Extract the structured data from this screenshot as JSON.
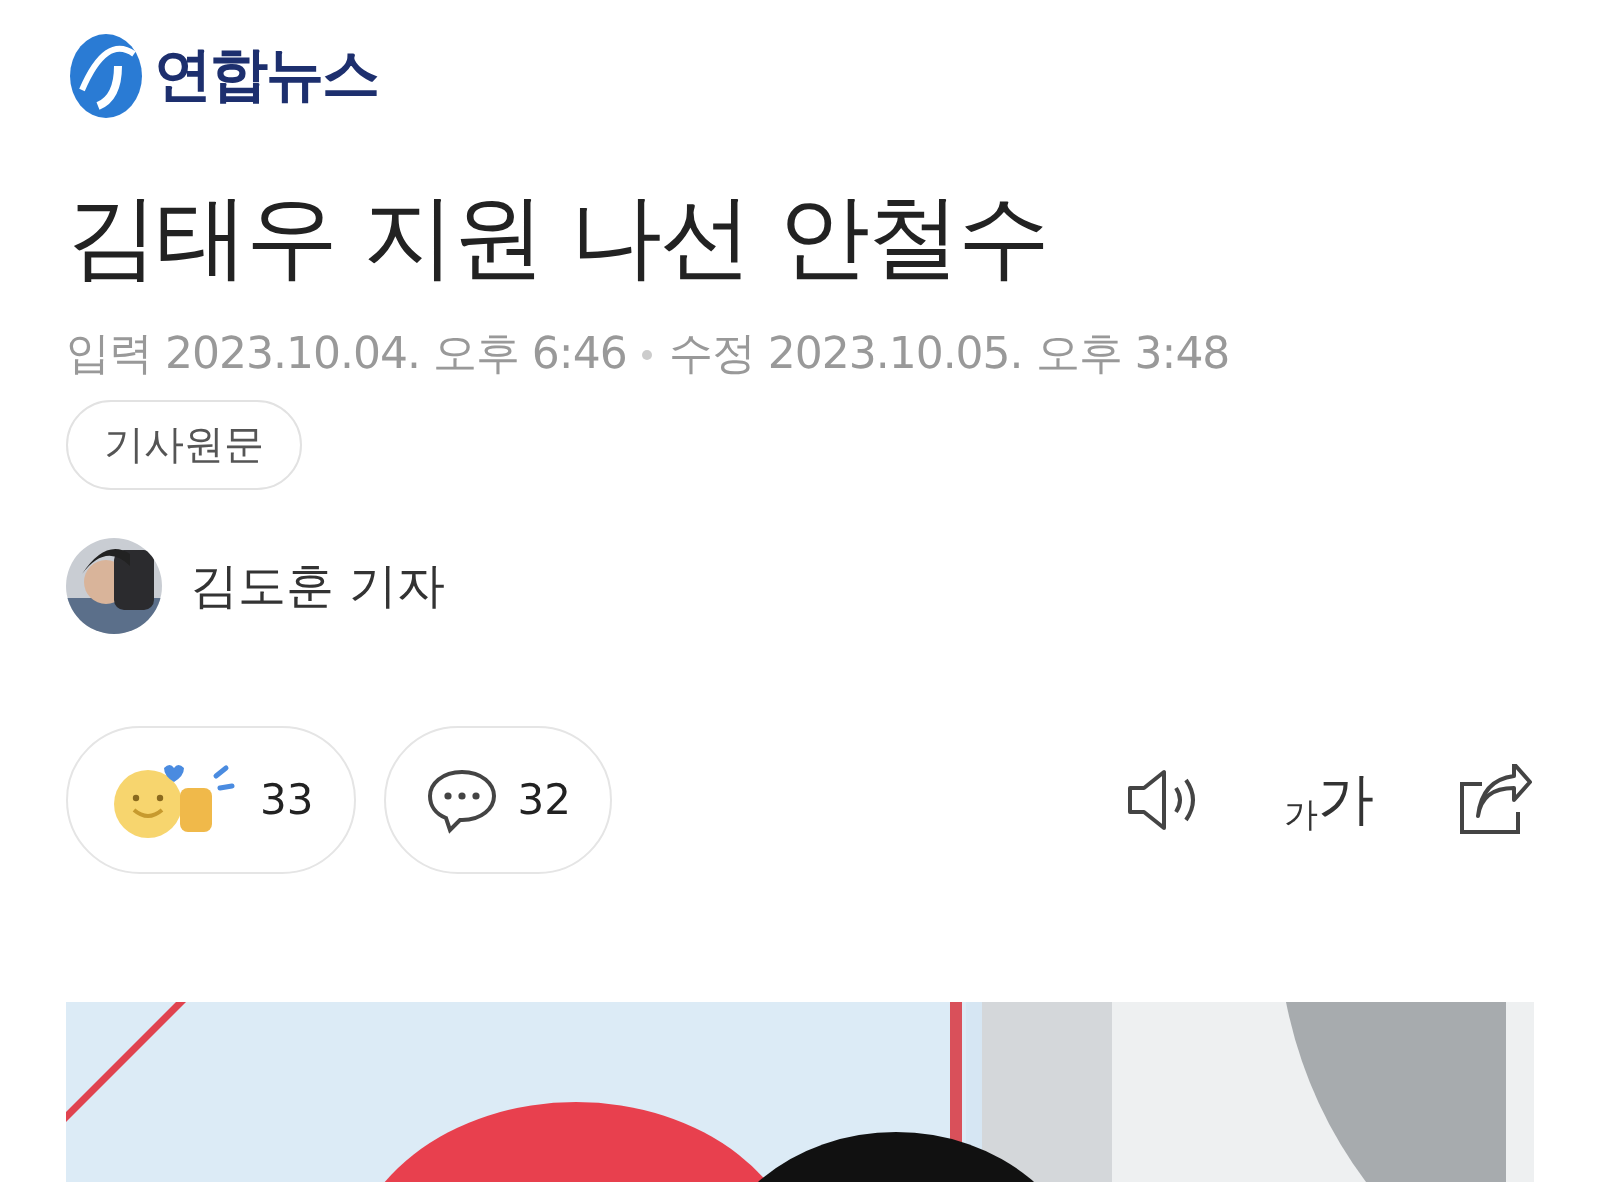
{
  "brand": {
    "name": "연합뉴스"
  },
  "headline": "김태우 지원 나선 안철수",
  "dates": [
    {
      "label": "입력",
      "value": "2023.10.04. 오후 6:46"
    },
    {
      "label": "수정",
      "value": "2023.10.05. 오후 3:48"
    }
  ],
  "original_link": "기사원문",
  "byline": {
    "reporter": "김도훈 기자"
  },
  "reactions": [
    {
      "kind": "like",
      "count": "33"
    },
    {
      "kind": "comment",
      "count": "32"
    }
  ],
  "tools": [
    {
      "kind": "listen"
    },
    {
      "kind": "font_size",
      "small": "가",
      "large": "가"
    },
    {
      "kind": "share"
    }
  ]
}
